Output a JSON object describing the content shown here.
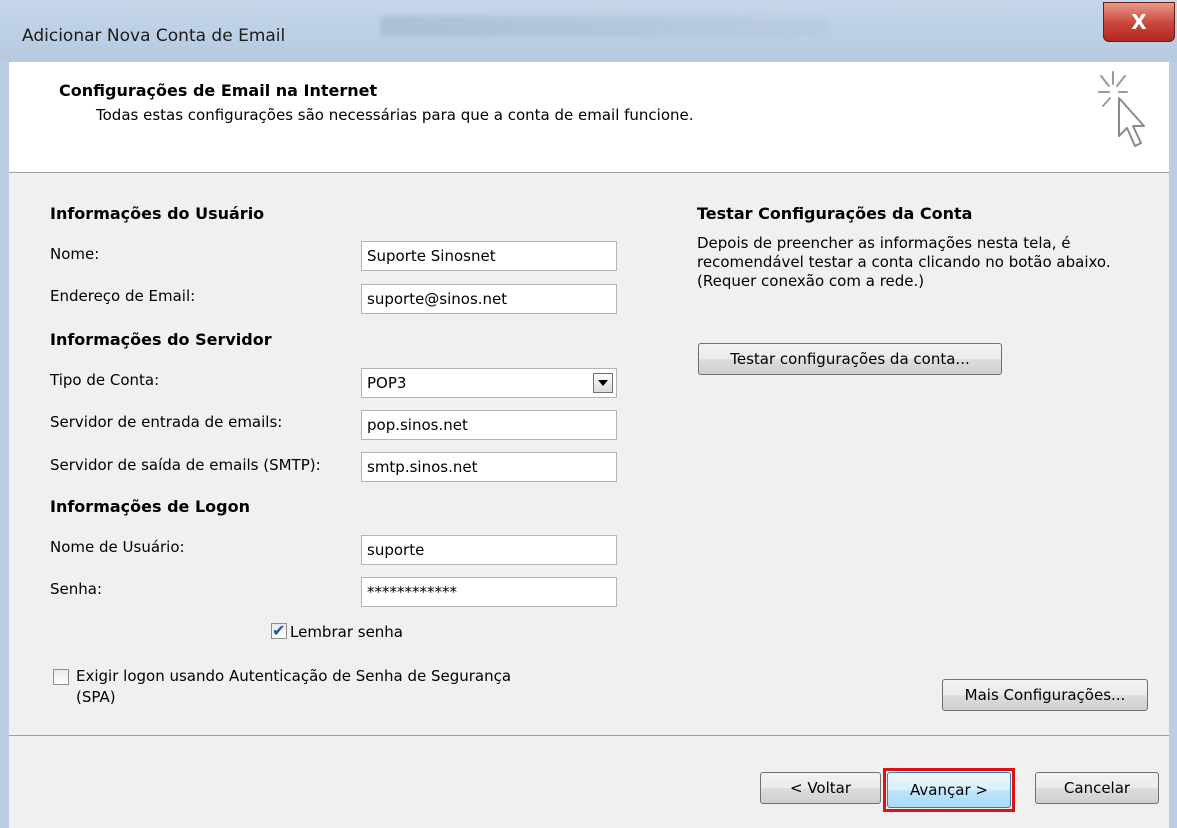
{
  "window": {
    "title": "Adicionar Nova Conta de Email",
    "close_label": "X"
  },
  "header": {
    "title": "Configurações de Email na Internet",
    "subtitle": "Todas estas configurações são necessárias para que a conta de email funcione.",
    "icon": "cursor-sparkle-icon"
  },
  "user_info": {
    "section_title": "Informações do Usuário",
    "name_label": "Nome:",
    "name_value": "Suporte Sinosnet",
    "email_label": "Endereço de Email:",
    "email_value": "suporte@sinos.net"
  },
  "server_info": {
    "section_title": "Informações do Servidor",
    "account_type_label": "Tipo de Conta:",
    "account_type_value": "POP3",
    "incoming_label": "Servidor de entrada de emails:",
    "incoming_value": "pop.sinos.net",
    "outgoing_label": "Servidor de saída de emails (SMTP):",
    "outgoing_value": "smtp.sinos.net"
  },
  "logon_info": {
    "section_title": "Informações de Logon",
    "username_label": "Nome de Usuário:",
    "username_value": "suporte",
    "password_label": "Senha:",
    "password_value": "************",
    "remember_label": "Lembrar senha",
    "remember_checked": true,
    "spa_label_line1": "Exigir logon usando Autenticação de Senha de Segurança",
    "spa_label_line2": "(SPA)",
    "spa_checked": false
  },
  "test_panel": {
    "title": "Testar Configurações da Conta",
    "desc_line1": "Depois de preencher as informações nesta tela, é",
    "desc_line2": "recomendável testar a conta clicando no botão abaixo.",
    "desc_line3": "(Requer conexão com a rede.)",
    "test_button": "Testar configurações da conta...",
    "more_settings_button": "Mais Configurações..."
  },
  "footer": {
    "back_button": "< Voltar",
    "next_button": "Avançar >",
    "cancel_button": "Cancelar"
  },
  "colors": {
    "highlight": "#e01010",
    "checkmark": "#1d56a3"
  }
}
